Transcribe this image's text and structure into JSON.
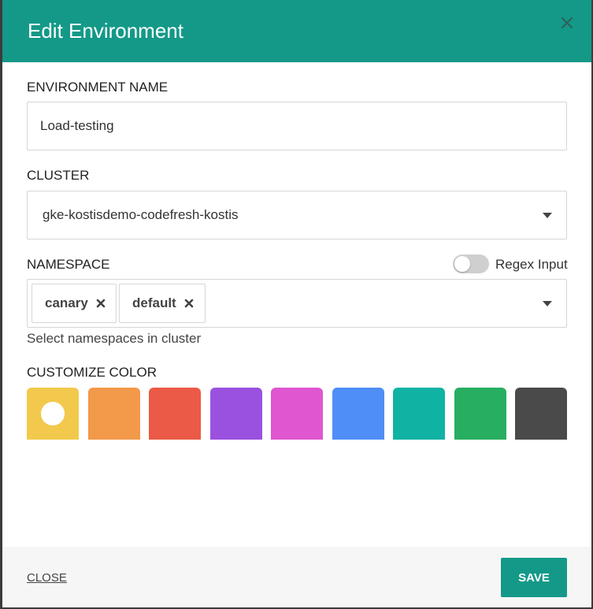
{
  "modal": {
    "title": "Edit Environment",
    "close_icon": "close-icon"
  },
  "environment_name": {
    "label": "ENVIRONMENT NAME",
    "value": "Load-testing"
  },
  "cluster": {
    "label": "CLUSTER",
    "selected": "gke-kostisdemo-codefresh-kostis",
    "icon": "chevron-down-icon"
  },
  "namespace": {
    "label": "NAMESPACE",
    "regex_toggle_label": "Regex Input",
    "regex_enabled": false,
    "chips": [
      {
        "label": "canary",
        "remove_icon": "remove-icon"
      },
      {
        "label": "default",
        "remove_icon": "remove-icon"
      }
    ],
    "help_text": "Select namespaces in cluster",
    "icon": "chevron-down-icon"
  },
  "customize_color": {
    "label": "CUSTOMIZE COLOR",
    "selected_index": 0,
    "colors": [
      "#f2c94c",
      "#f2994a",
      "#eb5a46",
      "#9b51e0",
      "#e056d0",
      "#4f8ef7",
      "#10b3a3",
      "#27ae60",
      "#4a4a4a"
    ]
  },
  "footer": {
    "close_label": "CLOSE",
    "save_label": "SAVE"
  },
  "colors": {
    "header": "#149988",
    "save_button": "#149988"
  }
}
